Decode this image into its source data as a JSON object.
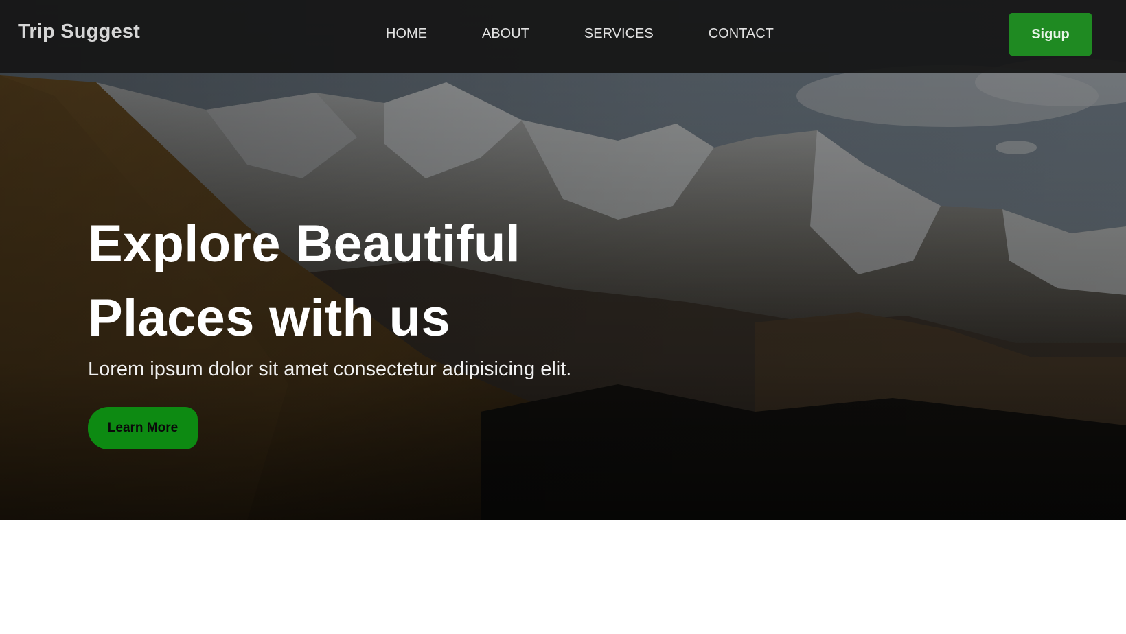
{
  "navbar": {
    "brand": "Trip Suggest",
    "links": [
      "HOME",
      "ABOUT",
      "SERVICES",
      "CONTACT"
    ],
    "signup_label": "Sigup"
  },
  "hero": {
    "title": "Explore Beautiful Places with us",
    "subtitle": "Lorem ipsum dolor sit amet consectetur adipisicing elit.",
    "cta_label": "Learn More"
  },
  "colors": {
    "navbar_bg": "#161616",
    "signup_button": "#1f8a22",
    "learn_more_button": "#0d8a12",
    "hero_text": "#ffffff"
  }
}
